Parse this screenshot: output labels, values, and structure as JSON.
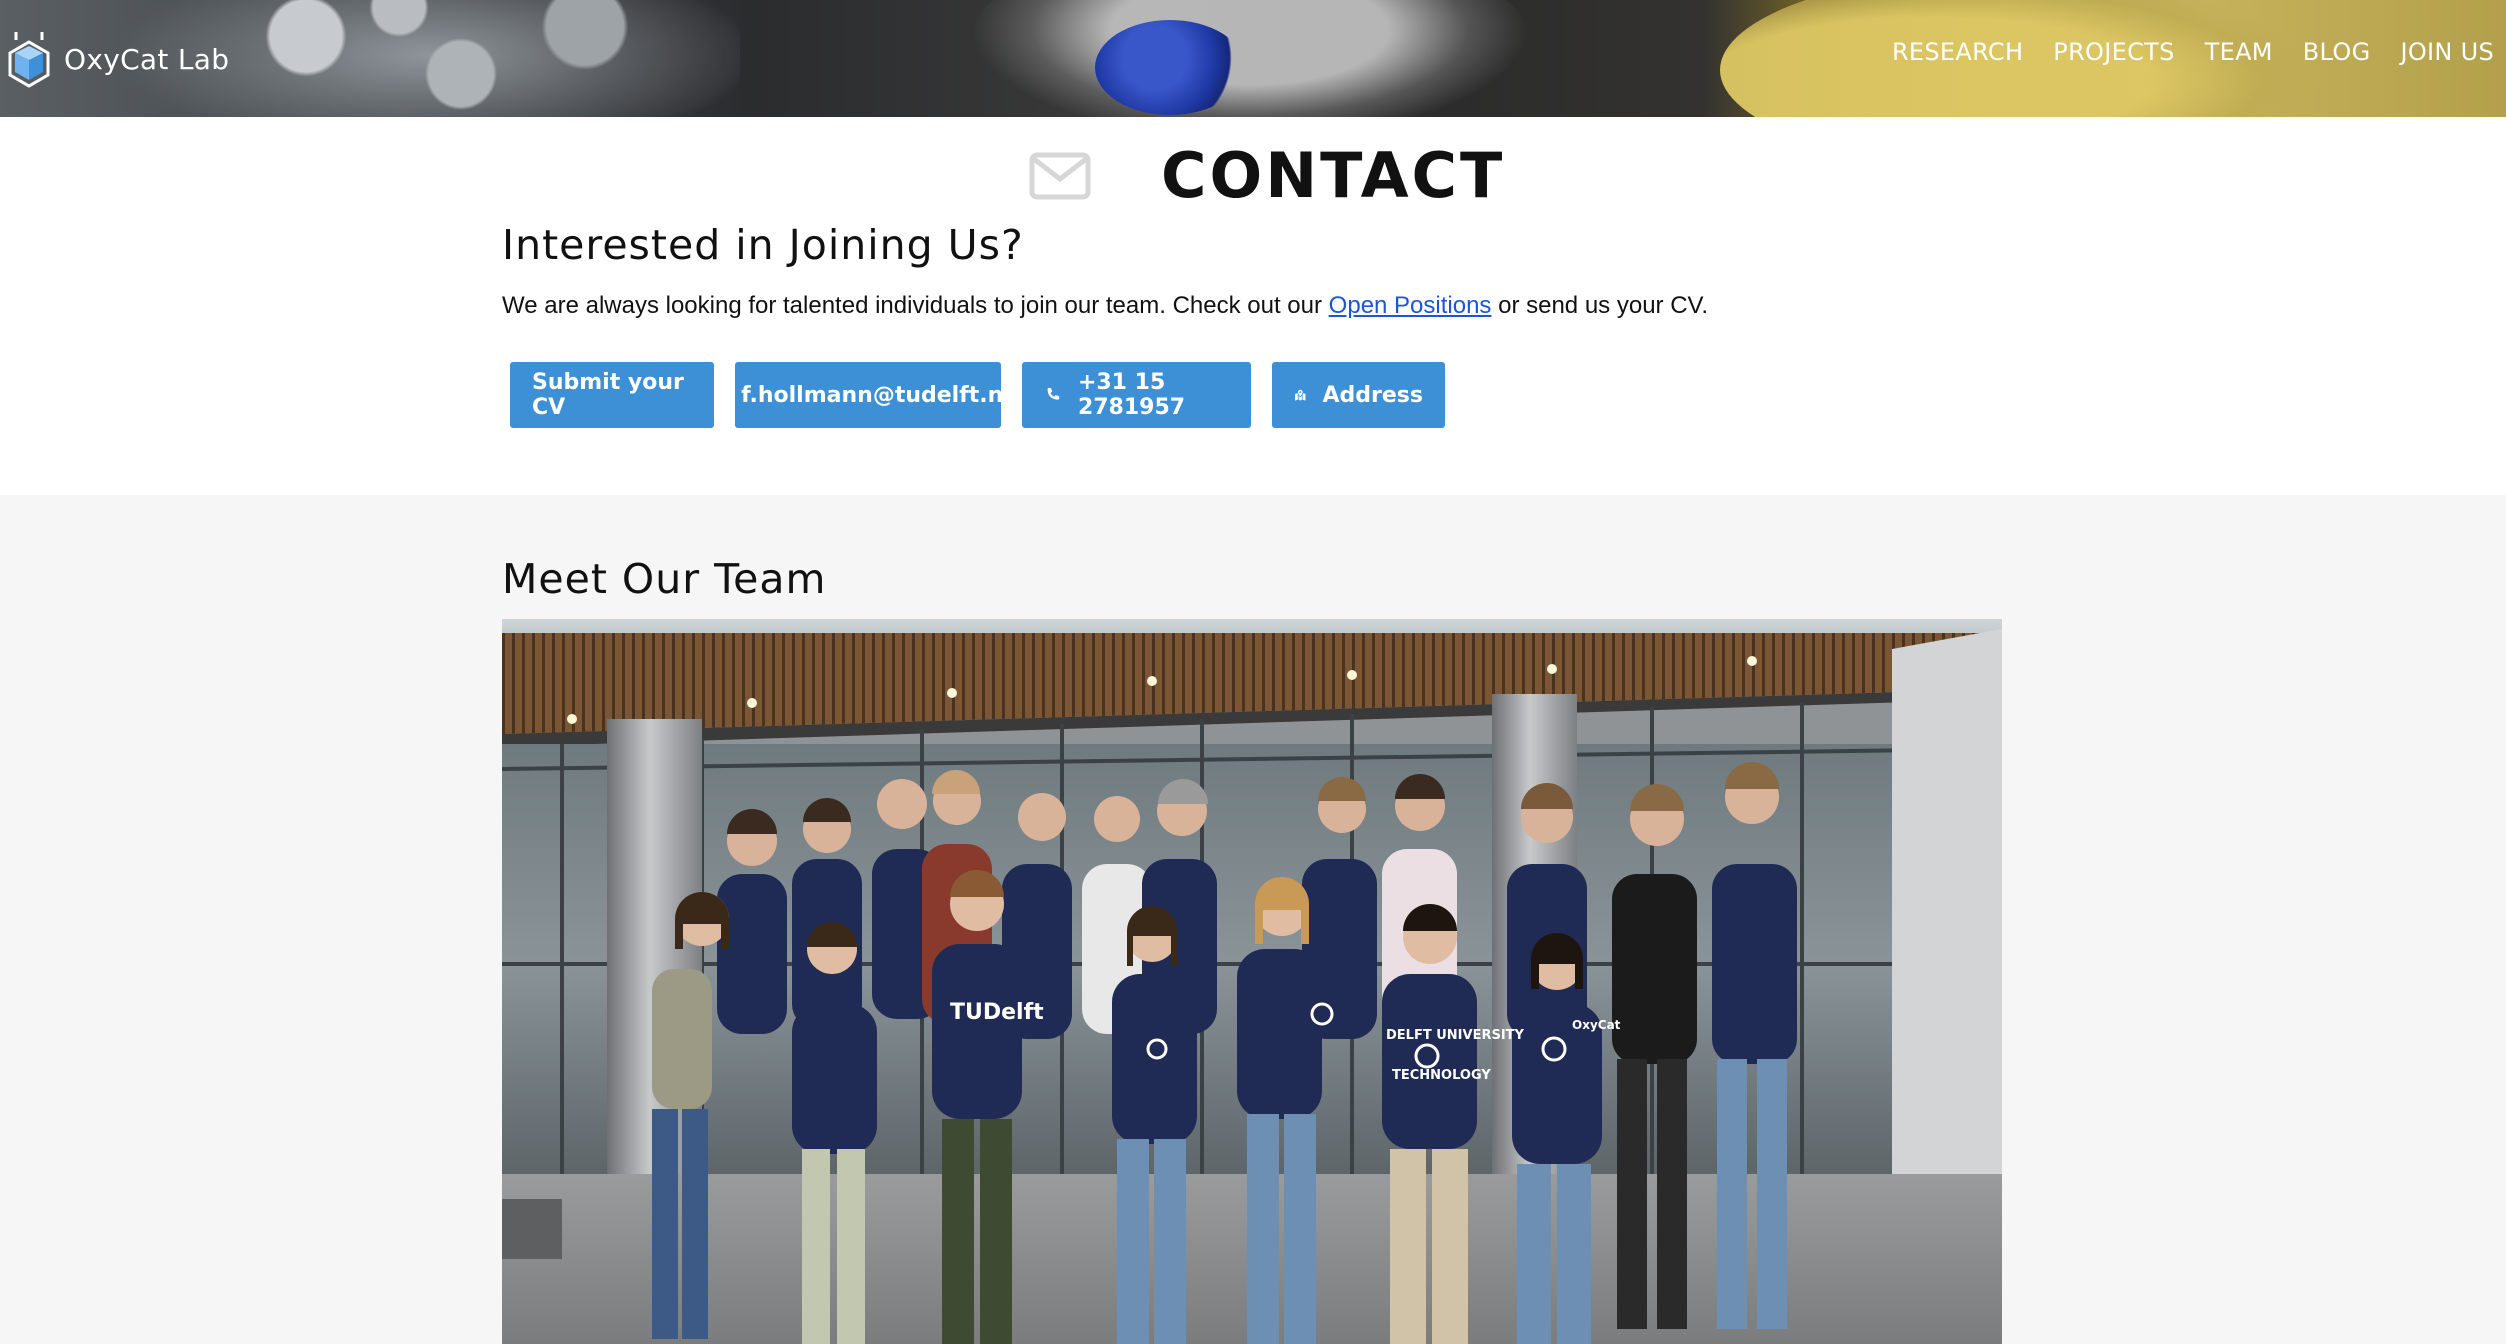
{
  "header": {
    "brand": "OxyCat Lab",
    "nav": [
      "RESEARCH",
      "PROJECTS",
      "TEAM",
      "BLOG",
      "JOIN US"
    ]
  },
  "contact": {
    "title": "CONTACT",
    "heading": "Interested in Joining Us?",
    "text_before": "We are always looking for talented individuals to join our team. Check out our ",
    "link": "Open Positions",
    "text_after": " or send us your CV.",
    "buttons": {
      "cv": "Submit your CV",
      "email": "f.hollmann@tudelft.nl",
      "phone": "+31 15 2781957",
      "address": "Address"
    }
  },
  "team": {
    "heading": "Meet Our Team",
    "photo_texts": [
      "TUDelft",
      "DELFT UNIVERSITY",
      "TECHNOLOGY",
      "OxyCat"
    ]
  },
  "colors": {
    "button": "#3d8fd6",
    "link": "#1a56db",
    "team_bg": "#f6f6f6",
    "sweater": "#1f2b55"
  },
  "icons": [
    "flask-logo-icon",
    "envelope-icon",
    "email-icon",
    "phone-icon",
    "map-icon"
  ]
}
